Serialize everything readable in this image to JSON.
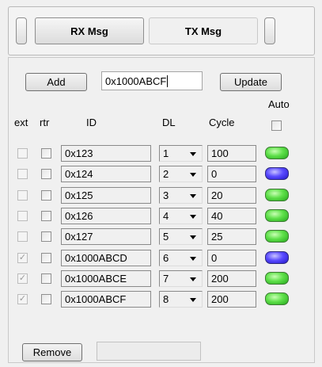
{
  "tabs": {
    "rx_label": "RX Msg",
    "tx_label": "TX Msg"
  },
  "toolbar": {
    "add_label": "Add",
    "id_value": "0x1000ABCF",
    "update_label": "Update"
  },
  "headers": {
    "ext": "ext",
    "rtr": "rtr",
    "id": "ID",
    "dl": "DL",
    "cycle": "Cycle",
    "auto": "Auto"
  },
  "rows": [
    {
      "ext": false,
      "rtr": false,
      "id": "0x123",
      "dl": "1",
      "cycle": "100",
      "led": "green"
    },
    {
      "ext": false,
      "rtr": false,
      "id": "0x124",
      "dl": "2",
      "cycle": "0",
      "led": "blue"
    },
    {
      "ext": false,
      "rtr": false,
      "id": "0x125",
      "dl": "3",
      "cycle": "20",
      "led": "green"
    },
    {
      "ext": false,
      "rtr": false,
      "id": "0x126",
      "dl": "4",
      "cycle": "40",
      "led": "green"
    },
    {
      "ext": false,
      "rtr": false,
      "id": "0x127",
      "dl": "5",
      "cycle": "25",
      "led": "green"
    },
    {
      "ext": true,
      "rtr": false,
      "id": "0x1000ABCD",
      "dl": "6",
      "cycle": "0",
      "led": "blue"
    },
    {
      "ext": true,
      "rtr": false,
      "id": "0x1000ABCE",
      "dl": "7",
      "cycle": "200",
      "led": "green"
    },
    {
      "ext": true,
      "rtr": false,
      "id": "0x1000ABCF",
      "dl": "8",
      "cycle": "200",
      "led": "green"
    }
  ],
  "footer": {
    "remove_label": "Remove",
    "status_value": ""
  },
  "colors": {
    "led_green": "#4cd43a",
    "led_blue": "#3a2cf0"
  }
}
